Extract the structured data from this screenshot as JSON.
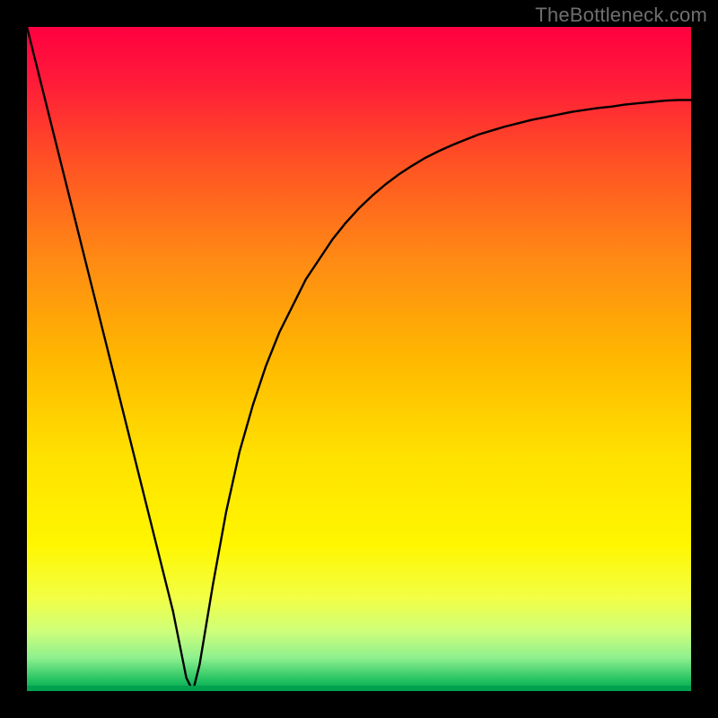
{
  "watermark": "TheBottleneck.com",
  "chart_data": {
    "type": "line",
    "title": "",
    "xlabel": "",
    "ylabel": "",
    "xlim": [
      0,
      100
    ],
    "ylim": [
      0,
      100
    ],
    "grid": false,
    "x": [
      0,
      2,
      4,
      6,
      8,
      10,
      12,
      14,
      16,
      18,
      20,
      22,
      23,
      24,
      25,
      26,
      27,
      28,
      30,
      32,
      34,
      36,
      38,
      40,
      42,
      44,
      46,
      48,
      50,
      52,
      54,
      56,
      58,
      60,
      62,
      64,
      66,
      68,
      70,
      72,
      74,
      76,
      78,
      80,
      82,
      84,
      86,
      88,
      90,
      92,
      94,
      96,
      98,
      100
    ],
    "values": [
      100,
      92,
      84,
      76,
      68,
      60,
      52,
      44,
      36,
      28,
      20,
      12,
      7,
      2,
      0,
      4,
      10,
      16,
      27,
      36,
      43,
      49,
      54,
      58,
      62,
      65,
      68,
      70.5,
      72.7,
      74.6,
      76.3,
      77.8,
      79.1,
      80.3,
      81.3,
      82.2,
      83,
      83.8,
      84.4,
      85,
      85.5,
      86,
      86.4,
      86.8,
      87.2,
      87.5,
      87.8,
      88,
      88.3,
      88.5,
      88.7,
      88.9,
      89,
      89
    ],
    "marker": {
      "x": 25,
      "y": 0,
      "color": "#cc6a6a"
    },
    "gradient_stops": [
      {
        "offset": 0.0,
        "color": "#ff0040"
      },
      {
        "offset": 0.08,
        "color": "#ff1a3a"
      },
      {
        "offset": 0.2,
        "color": "#ff5024"
      },
      {
        "offset": 0.35,
        "color": "#ff8a14"
      },
      {
        "offset": 0.5,
        "color": "#ffb800"
      },
      {
        "offset": 0.65,
        "color": "#ffe200"
      },
      {
        "offset": 0.78,
        "color": "#fff600"
      },
      {
        "offset": 0.86,
        "color": "#f2ff45"
      },
      {
        "offset": 0.91,
        "color": "#ceff7a"
      },
      {
        "offset": 0.95,
        "color": "#8ef08e"
      },
      {
        "offset": 0.985,
        "color": "#20c060"
      },
      {
        "offset": 1.0,
        "color": "#02a14f"
      }
    ]
  }
}
